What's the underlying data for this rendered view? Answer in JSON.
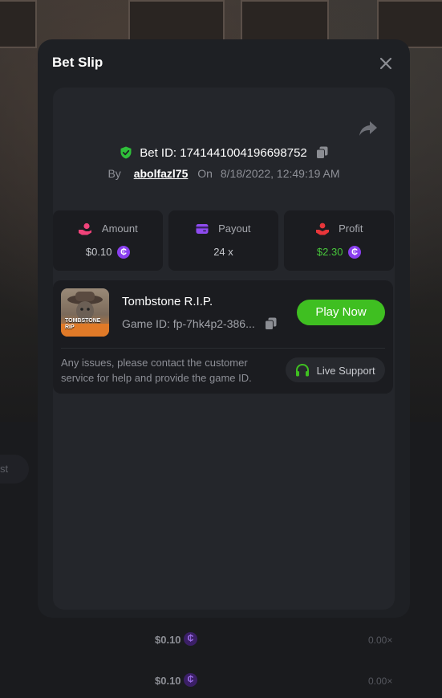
{
  "modal": {
    "title": "Bet Slip",
    "bet_id_label": "Bet ID: 1741441004196698752",
    "by_label": "By",
    "username": "abolfazl75",
    "on_label": "On",
    "date": "8/18/2022, 12:49:19 AM"
  },
  "stats": {
    "amount": {
      "label": "Amount",
      "value": "$0.10",
      "icon": "coins-hand-icon",
      "color": "#f0437a"
    },
    "payout": {
      "label": "Payout",
      "value": "24 x",
      "icon": "wallet-card-icon",
      "color": "#8f4bf0"
    },
    "profit": {
      "label": "Profit",
      "value": "$2.30",
      "icon": "hand-coin-icon",
      "color": "#e8363a",
      "value_color": "#47c53b"
    }
  },
  "currency_symbol": "₵",
  "game": {
    "name": "Tombstone R.I.P.",
    "id_label": "Game ID: fp-7hk4p2-386...",
    "thumb_title": "TOMBSTONE RIP",
    "play_label": "Play Now"
  },
  "support": {
    "text": "Any issues, please contact the customer service for help and provide the game ID.",
    "live_label": "Live Support"
  },
  "background": {
    "pill_label": "st",
    "rows": [
      {
        "amount": "$0.10",
        "multiplier": "0.00×"
      },
      {
        "amount": "$0.10",
        "multiplier": "0.00×"
      }
    ]
  },
  "colors": {
    "accent_green": "#3fbf21",
    "coin_purple": "#8a3ff0",
    "modal_bg": "#1e2024"
  }
}
